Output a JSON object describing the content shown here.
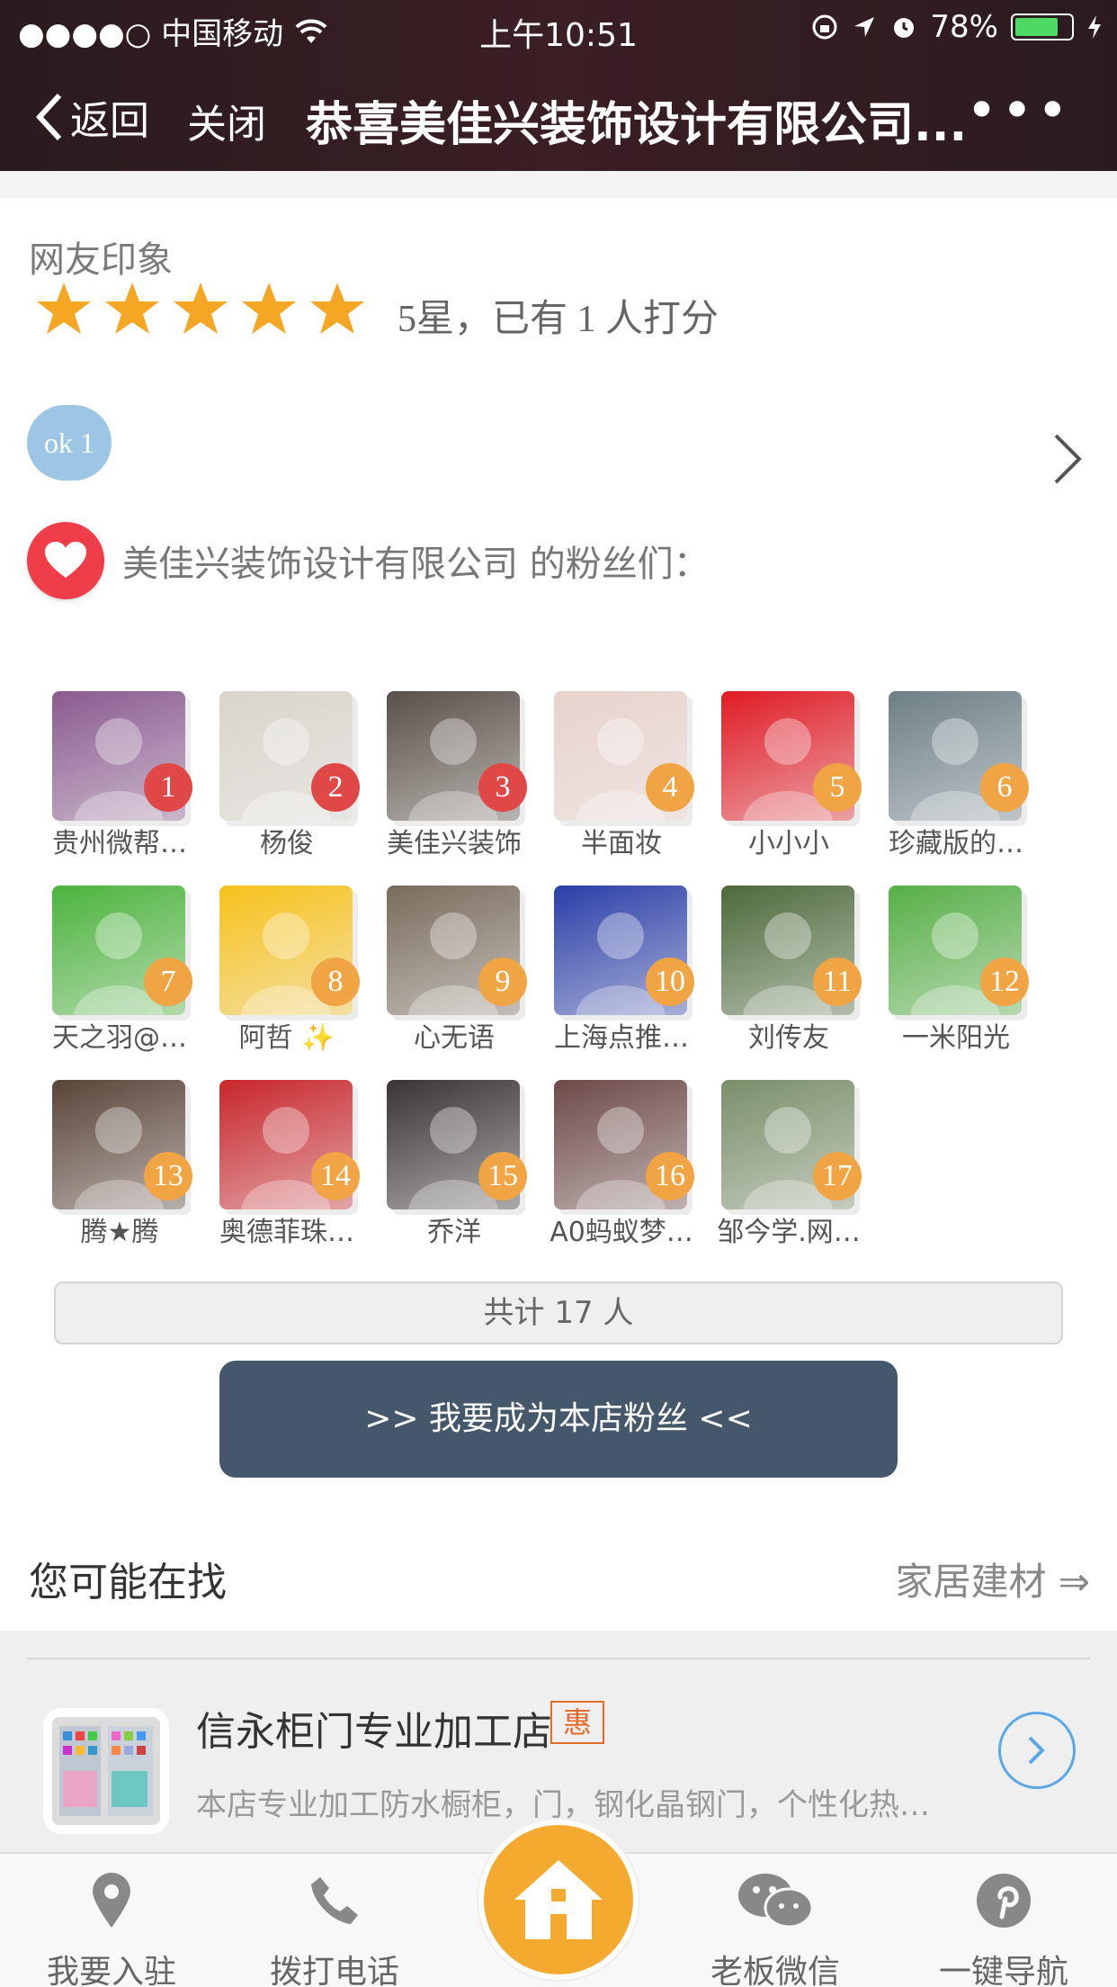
{
  "status_bar": {
    "carrier": "●●●●○ 中国移动",
    "time": "上午10:51",
    "battery": "78%",
    "battery_level": 0.78
  },
  "nav": {
    "back_label": "返回",
    "close_label": "关闭",
    "title": "恭喜美佳兴装饰设计有限公司...",
    "more": "•••"
  },
  "rating": {
    "section_title": "网友印象",
    "stars": 5,
    "summary": "5星，已有 1 人打分",
    "tag": "ok 1"
  },
  "fans": {
    "title": "美佳兴装饰设计有限公司 的粉丝们：",
    "items": [
      {
        "num": "1",
        "name": "贵州微帮…"
      },
      {
        "num": "2",
        "name": "杨俊"
      },
      {
        "num": "3",
        "name": "美佳兴装饰"
      },
      {
        "num": "4",
        "name": "半面妆"
      },
      {
        "num": "5",
        "name": "小小小"
      },
      {
        "num": "6",
        "name": "珍藏版的…"
      },
      {
        "num": "7",
        "name": "天之羽@…"
      },
      {
        "num": "8",
        "name": "阿哲 ✨"
      },
      {
        "num": "9",
        "name": "心无语"
      },
      {
        "num": "10",
        "name": "上海点推…"
      },
      {
        "num": "11",
        "name": "刘传友"
      },
      {
        "num": "12",
        "name": "一米阳光"
      },
      {
        "num": "13",
        "name": "腾★腾"
      },
      {
        "num": "14",
        "name": "奥德菲珠…"
      },
      {
        "num": "15",
        "name": "乔洋"
      },
      {
        "num": "16",
        "name": "A0蚂蚁梦…"
      },
      {
        "num": "17",
        "name": "邹今学.网…"
      }
    ],
    "total": "共计 17 人",
    "join_button": ">> 我要成为本店粉丝 <<"
  },
  "suggest": {
    "title": "您可能在找",
    "category_link": "家居建材 ⇒",
    "store": {
      "name": "信永柜门专业加工店",
      "tag": "惠",
      "desc": "本店专业加工防水橱柜，门，钢化晶钢门，个性化热…"
    }
  },
  "tabbar": {
    "items": [
      {
        "label": "我要入驻",
        "icon": "location-pin-icon"
      },
      {
        "label": "拨打电话",
        "icon": "phone-icon"
      },
      {
        "label": "老板微信",
        "icon": "wechat-icon"
      },
      {
        "label": "一键导航",
        "icon": "pinterest-nav-icon"
      }
    ],
    "home_icon": "home-icon"
  },
  "colors": {
    "accent_orange": "#f3aa2e",
    "button_dark": "#45586b",
    "heart_red": "#ef3e4a",
    "badge_red": "#e04848",
    "badge_orange": "#f0a444"
  }
}
